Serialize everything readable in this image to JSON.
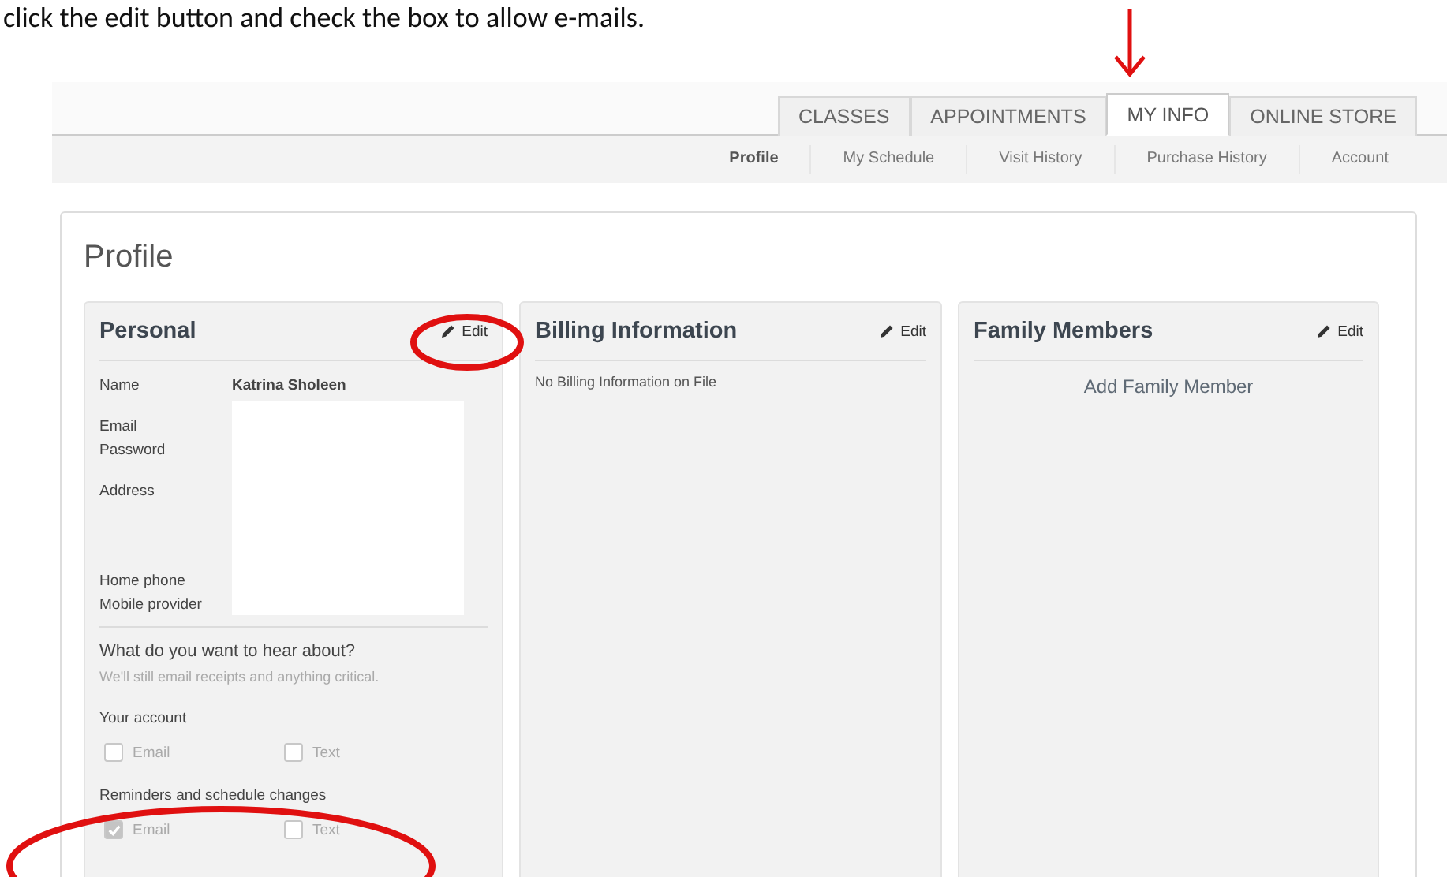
{
  "caption": "click the edit button and check the box to allow e-mails.",
  "tabs": [
    {
      "label": "CLASSES",
      "selected": false
    },
    {
      "label": "APPOINTMENTS",
      "selected": false
    },
    {
      "label": "MY INFO",
      "selected": true
    },
    {
      "label": "ONLINE STORE",
      "selected": false
    }
  ],
  "subnav": [
    {
      "label": "Profile",
      "selected": true
    },
    {
      "label": "My Schedule",
      "selected": false
    },
    {
      "label": "Visit History",
      "selected": false
    },
    {
      "label": "Purchase History",
      "selected": false
    },
    {
      "label": "Account",
      "selected": false
    }
  ],
  "page_title": "Profile",
  "personal": {
    "title": "Personal",
    "edit": "Edit",
    "name_label": "Name",
    "name_value": "Katrina Sholeen",
    "fields": [
      "Email",
      "Password",
      "Address",
      "Home phone",
      "Mobile provider"
    ],
    "question": "What do you want to hear about?",
    "hint": "We'll still email receipts and anything critical.",
    "groups": [
      {
        "title": "Your account",
        "options": [
          {
            "label": "Email",
            "checked": false,
            "disabled": true
          },
          {
            "label": "Text",
            "checked": false,
            "disabled": true
          }
        ]
      },
      {
        "title": "Reminders and schedule changes",
        "options": [
          {
            "label": "Email",
            "checked": true,
            "disabled": true
          },
          {
            "label": "Text",
            "checked": false,
            "disabled": true
          }
        ]
      }
    ]
  },
  "billing": {
    "title": "Billing Information",
    "edit": "Edit",
    "text": "No Billing Information on File"
  },
  "family": {
    "title": "Family Members",
    "edit": "Edit",
    "link": "Add Family Member"
  }
}
